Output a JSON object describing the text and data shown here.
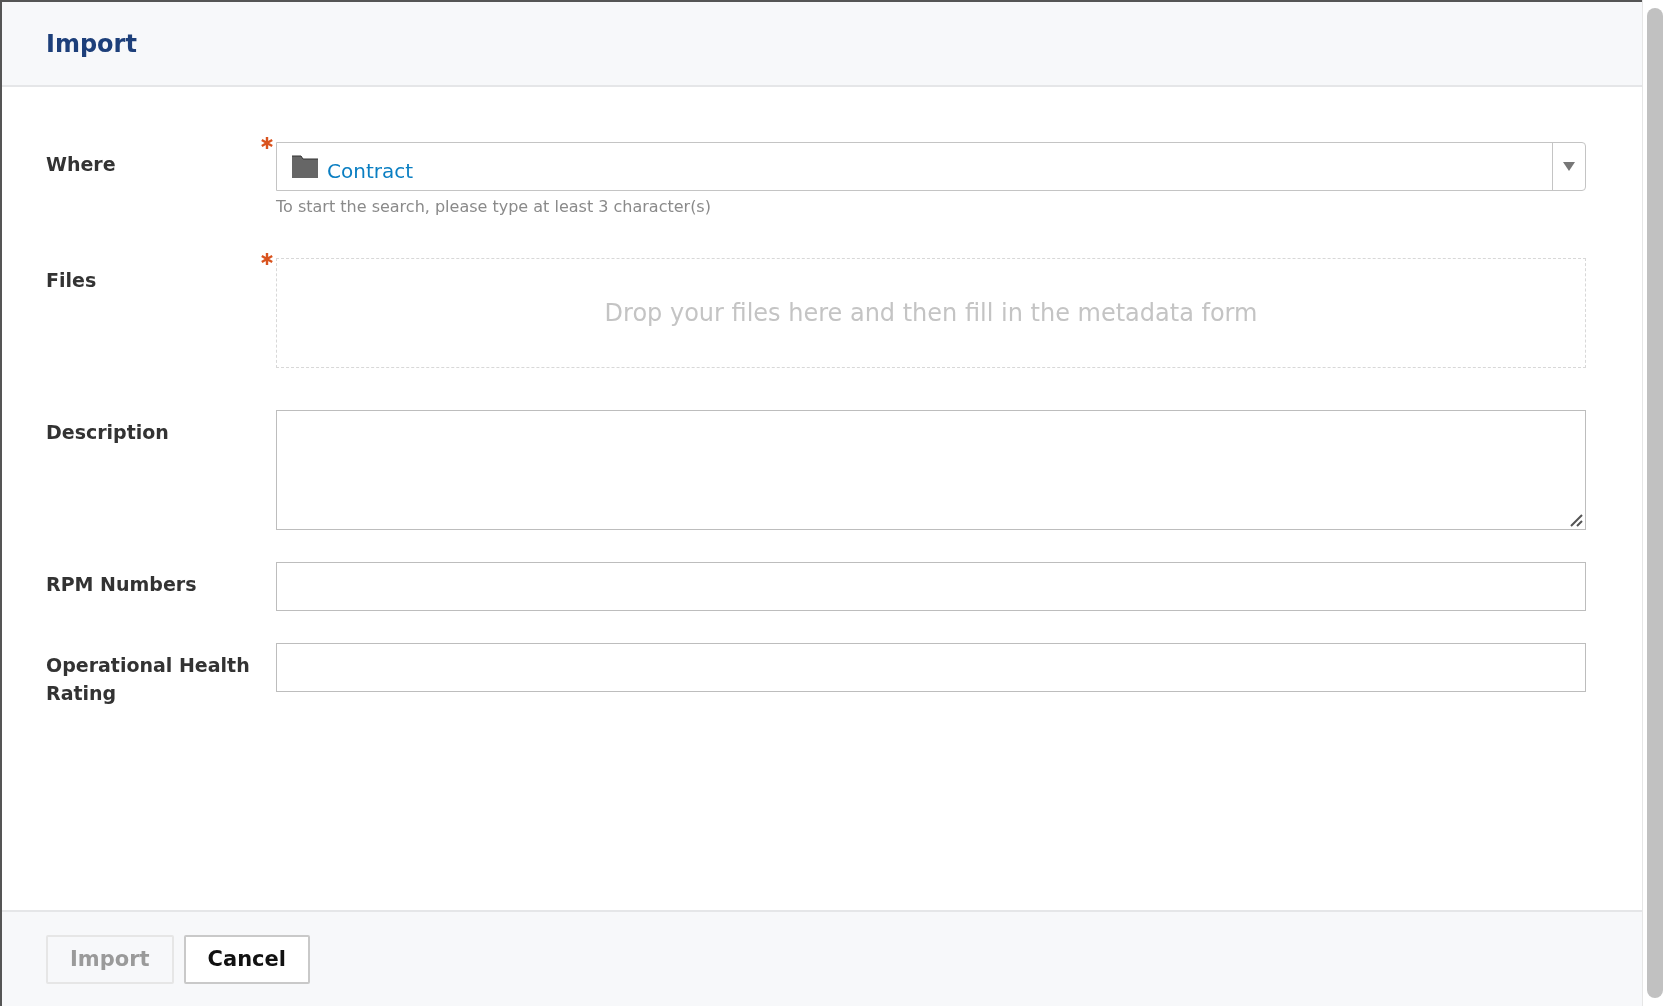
{
  "dialog": {
    "title": "Import"
  },
  "fields": [
    {
      "kind": "select",
      "label": "Where",
      "required": true,
      "value": "Contract",
      "hint": "To start the search, please type at least 3 character(s)"
    },
    {
      "kind": "dropzone",
      "label": "Files",
      "required": true,
      "placeholder": "Drop your files here and then fill in the metadata form"
    },
    {
      "kind": "textarea",
      "label": "Description",
      "required": false
    },
    {
      "kind": "text",
      "label": "RPM Numbers",
      "required": false
    },
    {
      "kind": "text",
      "label": "Operational Health Rating",
      "required": false
    }
  ],
  "buttons": [
    {
      "label": "Import",
      "disabled": true
    },
    {
      "label": "Cancel",
      "disabled": false
    }
  ]
}
